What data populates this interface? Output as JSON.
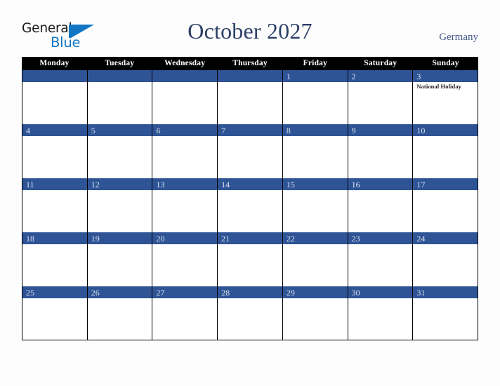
{
  "brand": {
    "logo_text_primary": "General",
    "logo_text_secondary": "Blue",
    "logo_icon": "triangle-flag-icon",
    "primary_color": "#1177c4"
  },
  "header": {
    "title": "October 2027",
    "country": "Germany",
    "title_color": "#2b3f66",
    "country_color": "#44578a"
  },
  "calendar": {
    "month": "October",
    "year": "2027",
    "accent_color": "#2e5496",
    "header_bg": "#000000",
    "weekdays": [
      "Monday",
      "Tuesday",
      "Wednesday",
      "Thursday",
      "Friday",
      "Saturday",
      "Sunday"
    ],
    "weeks": [
      [
        {
          "day": "",
          "events": []
        },
        {
          "day": "",
          "events": []
        },
        {
          "day": "",
          "events": []
        },
        {
          "day": "",
          "events": []
        },
        {
          "day": "1",
          "events": []
        },
        {
          "day": "2",
          "events": []
        },
        {
          "day": "3",
          "events": [
            "National Holiday"
          ]
        }
      ],
      [
        {
          "day": "4",
          "events": []
        },
        {
          "day": "5",
          "events": []
        },
        {
          "day": "6",
          "events": []
        },
        {
          "day": "7",
          "events": []
        },
        {
          "day": "8",
          "events": []
        },
        {
          "day": "9",
          "events": []
        },
        {
          "day": "10",
          "events": []
        }
      ],
      [
        {
          "day": "11",
          "events": []
        },
        {
          "day": "12",
          "events": []
        },
        {
          "day": "13",
          "events": []
        },
        {
          "day": "14",
          "events": []
        },
        {
          "day": "15",
          "events": []
        },
        {
          "day": "16",
          "events": []
        },
        {
          "day": "17",
          "events": []
        }
      ],
      [
        {
          "day": "18",
          "events": []
        },
        {
          "day": "19",
          "events": []
        },
        {
          "day": "20",
          "events": []
        },
        {
          "day": "21",
          "events": []
        },
        {
          "day": "22",
          "events": []
        },
        {
          "day": "23",
          "events": []
        },
        {
          "day": "24",
          "events": []
        }
      ],
      [
        {
          "day": "25",
          "events": []
        },
        {
          "day": "26",
          "events": []
        },
        {
          "day": "27",
          "events": []
        },
        {
          "day": "28",
          "events": []
        },
        {
          "day": "29",
          "events": []
        },
        {
          "day": "30",
          "events": []
        },
        {
          "day": "31",
          "events": []
        }
      ]
    ]
  }
}
